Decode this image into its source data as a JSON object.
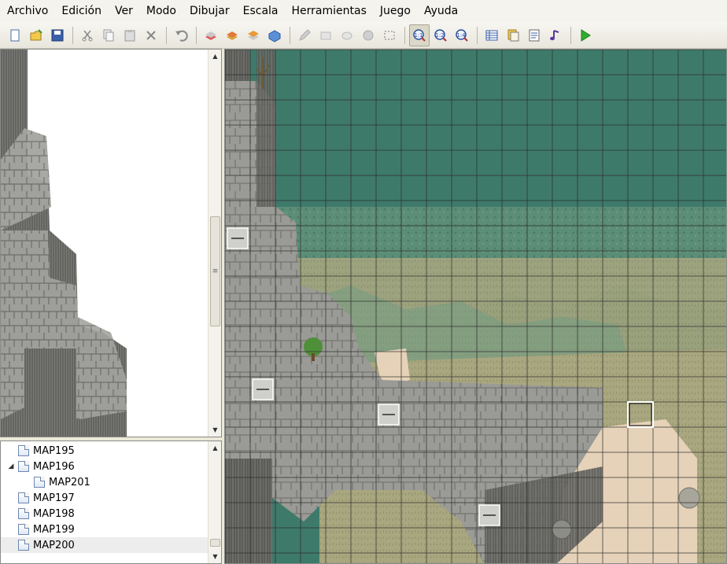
{
  "menu": [
    "Archivo",
    "Edición",
    "Ver",
    "Modo",
    "Dibujar",
    "Escala",
    "Herramientas",
    "Juego",
    "Ayuda"
  ],
  "toolbar": {
    "groups": [
      [
        "new-file-icon",
        "open-folder-icon",
        "save-icon"
      ],
      [
        "cut-icon",
        "copy-icon",
        "paste-icon",
        "delete-icon"
      ],
      [
        "undo-icon"
      ],
      [
        "lower-layer-icon",
        "middle-layer-icon",
        "upper-layer-icon",
        "event-layer-icon"
      ],
      [
        "pencil-icon",
        "rectangle-icon",
        "ellipse-icon",
        "fill-icon",
        "select-icon"
      ],
      [
        "zoom-1-1-icon",
        "zoom-1-2-icon",
        "zoom-1-4-icon"
      ],
      [
        "database-icon",
        "resource-manager-icon",
        "script-editor-icon",
        "sound-test-icon"
      ],
      [
        "play-test-icon"
      ]
    ],
    "active": "zoom-1-1-icon"
  },
  "map_tree": {
    "items": [
      {
        "label": "MAP195",
        "level": 0,
        "expander": "",
        "selected": false
      },
      {
        "label": "MAP196",
        "level": 0,
        "expander": "◢",
        "selected": false
      },
      {
        "label": "MAP201",
        "level": 1,
        "expander": "",
        "selected": false
      },
      {
        "label": "MAP197",
        "level": 0,
        "expander": "",
        "selected": false
      },
      {
        "label": "MAP198",
        "level": 0,
        "expander": "",
        "selected": false
      },
      {
        "label": "MAP199",
        "level": 0,
        "expander": "",
        "selected": false
      },
      {
        "label": "MAP200",
        "level": 0,
        "expander": "",
        "selected": true
      }
    ]
  },
  "colors": {
    "water": "#3e7a6a",
    "grass": "#a9a77f",
    "sand": "#e6d2b9",
    "rock": "#9a9a96",
    "cliff": "#6d6d69",
    "grid": "#2c2c2c",
    "cursor": "#ffffff"
  },
  "map": {
    "tile_cursor": {
      "col": 16,
      "row": 14
    }
  }
}
